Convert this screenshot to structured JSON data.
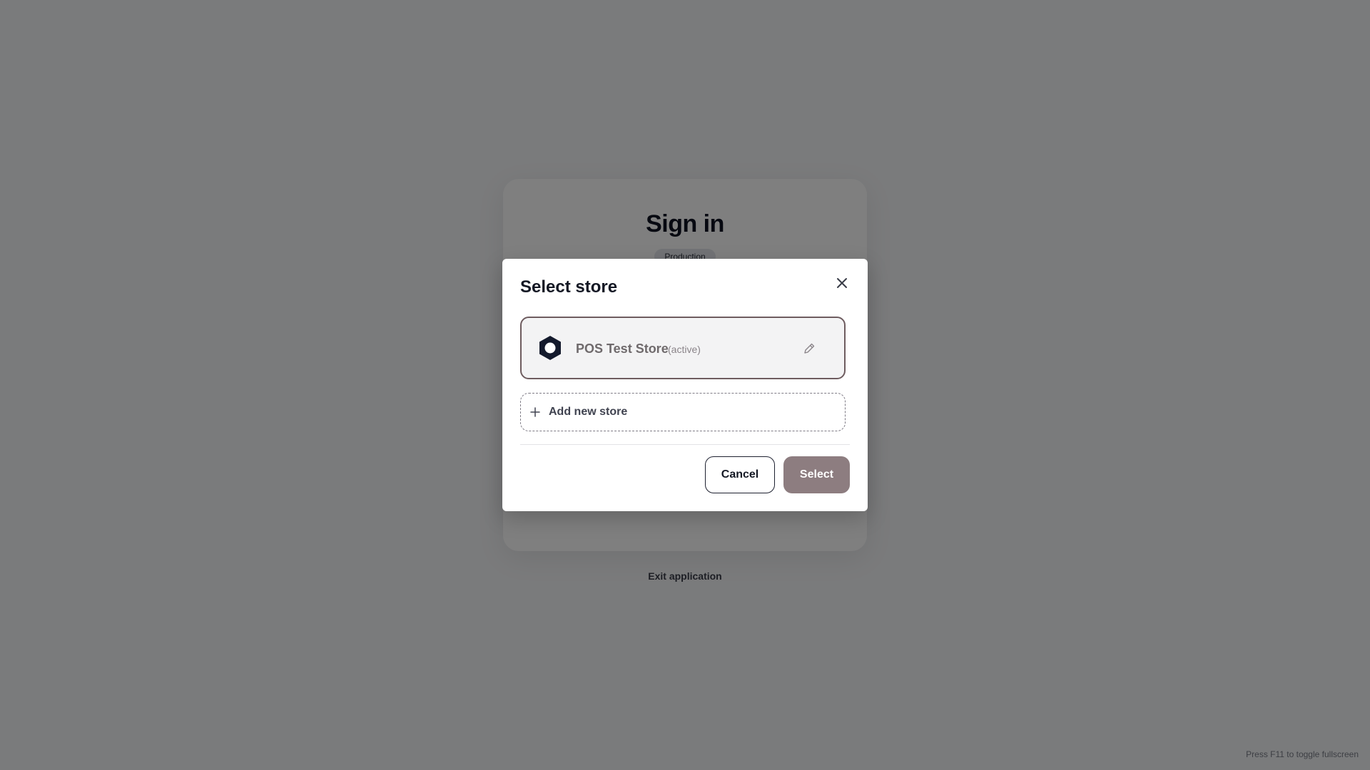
{
  "background": {
    "signin_title": "Sign in",
    "environment_badge": "Production",
    "exit_link": "Exit application",
    "fullscreen_hint": "Press F11 to toggle fullscreen"
  },
  "modal": {
    "title": "Select store",
    "close_icon": "close-icon",
    "stores": [
      {
        "name": "POS Test Store",
        "status": "(active)",
        "icon": "hexagon-store-icon",
        "edit_icon": "pencil-icon",
        "selected": true
      }
    ],
    "add_store_label": "Add new store",
    "add_store_icon": "plus-icon",
    "cancel_label": "Cancel",
    "select_label": "Select"
  },
  "colors": {
    "selected_border": "#6e5c5f",
    "select_button": "#8d7d80",
    "overlay": "rgba(0,0,0,0.5)",
    "dark_text": "#141824"
  }
}
